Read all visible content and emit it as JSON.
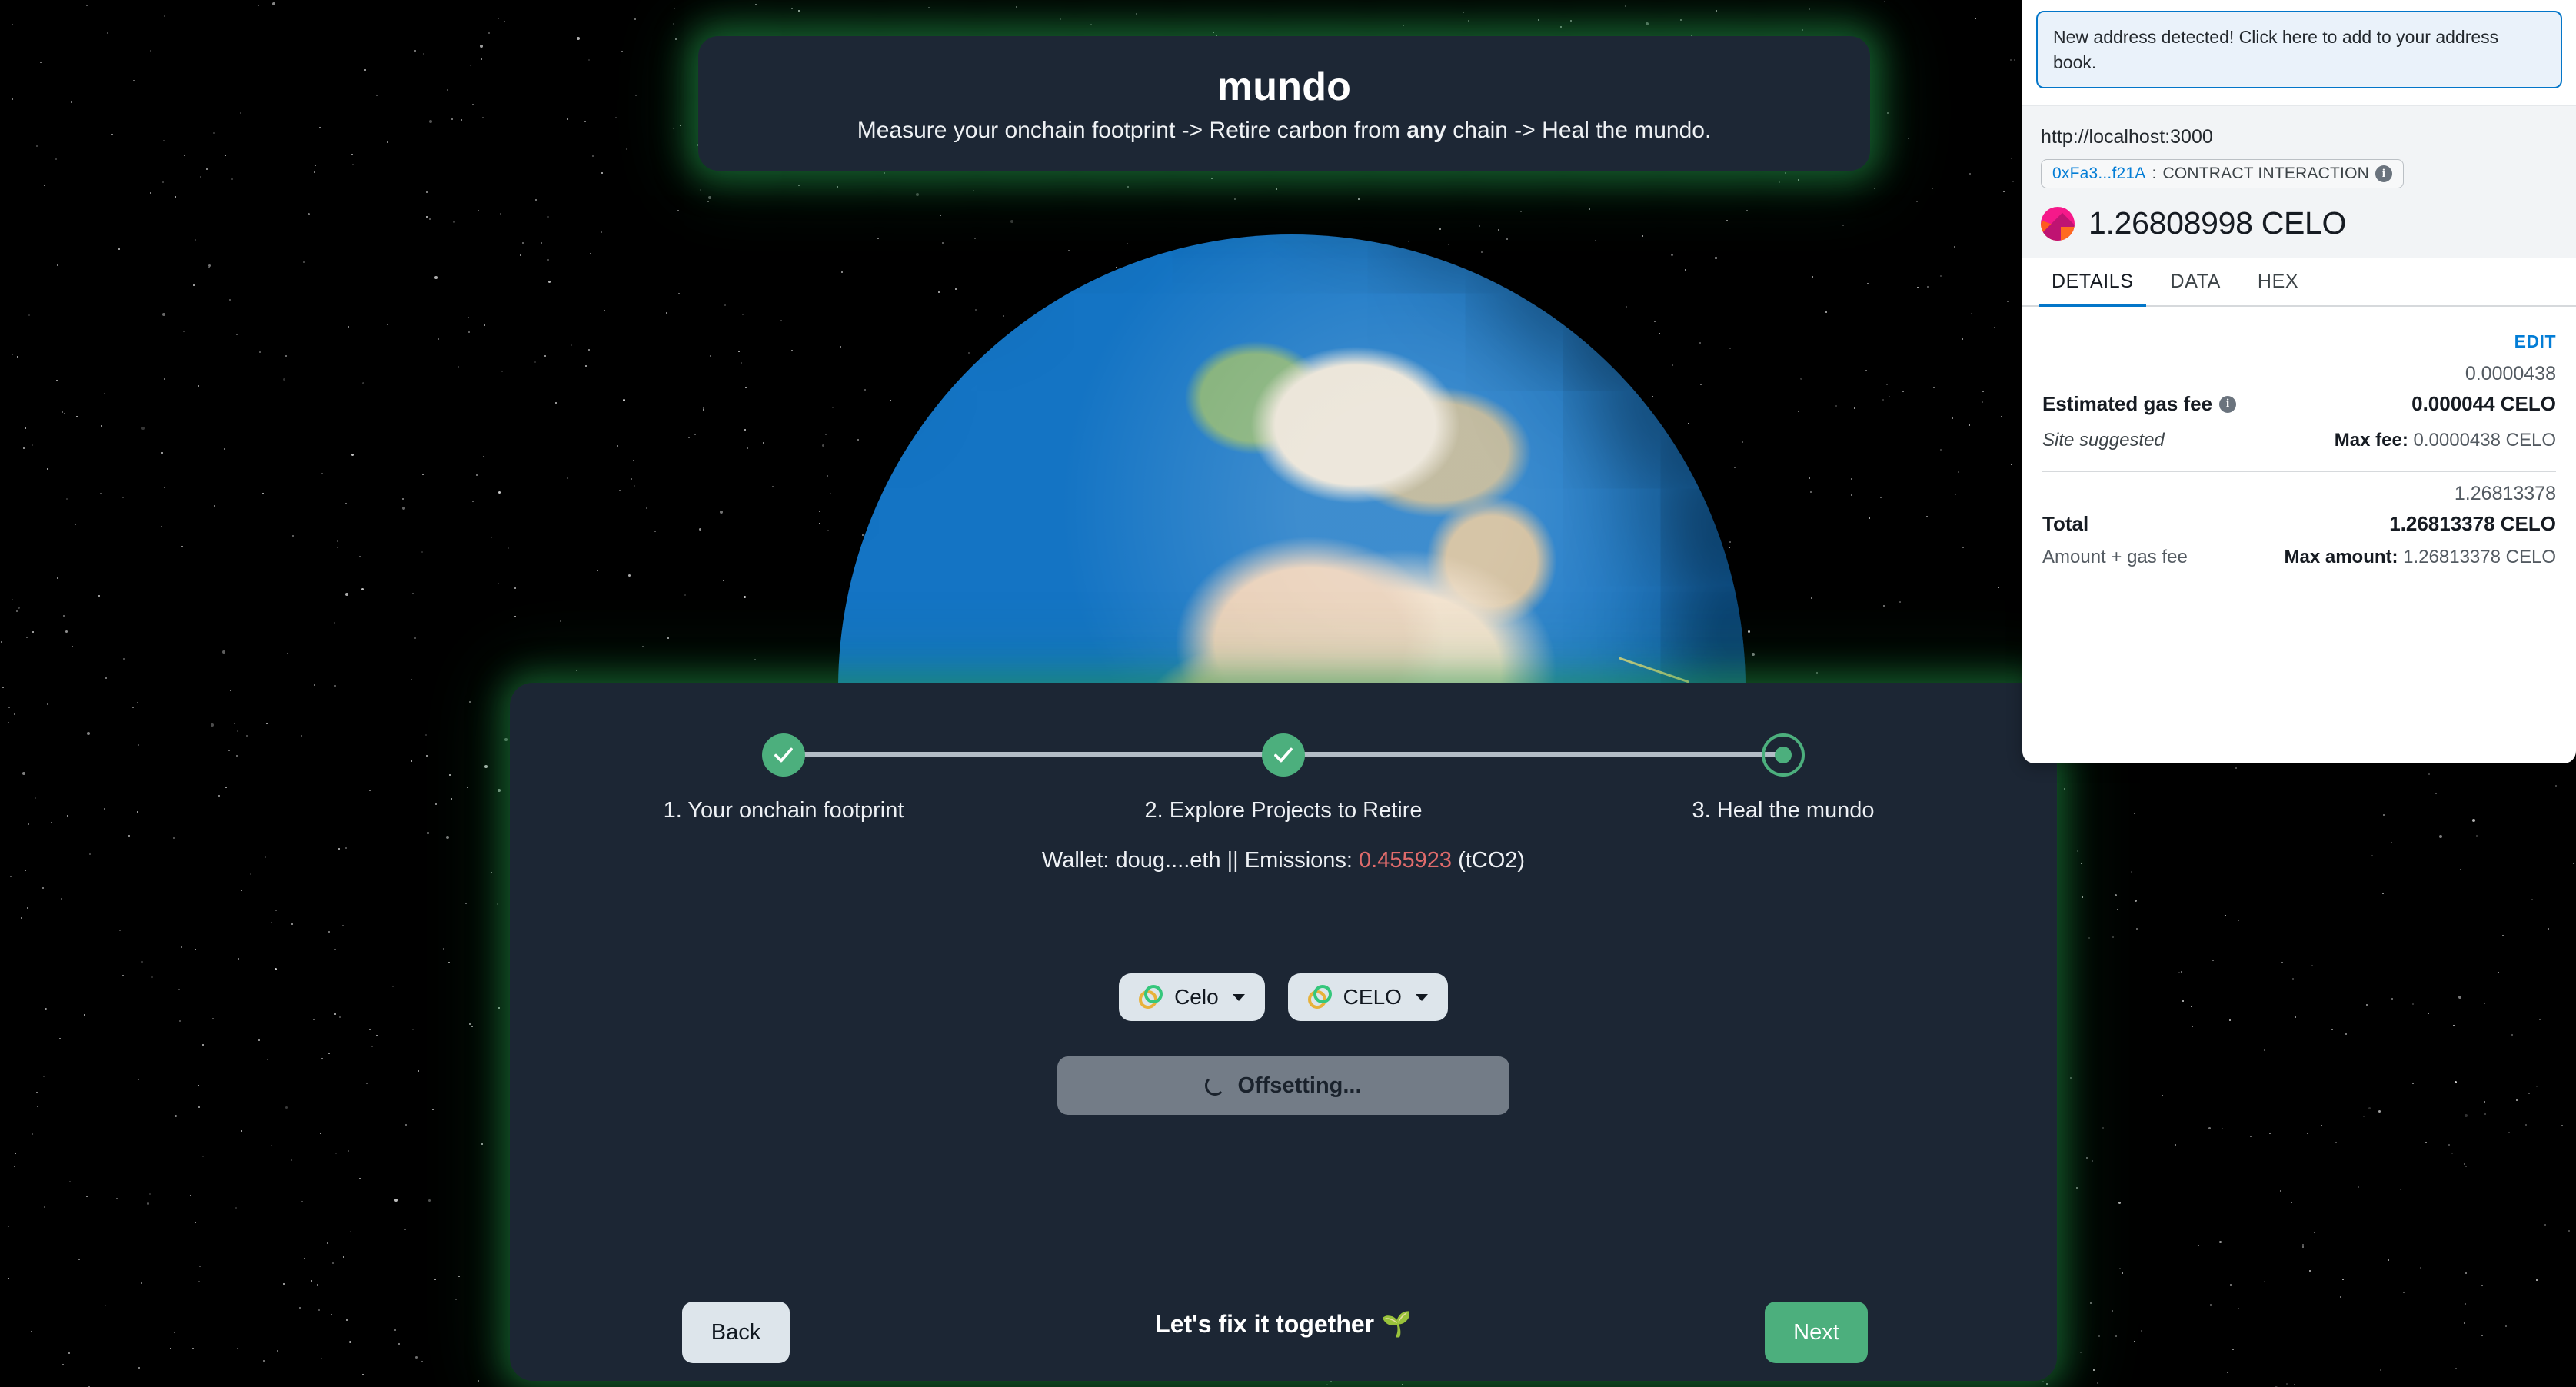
{
  "app": {
    "brand_title": "mundo",
    "tagline_before": "Measure your onchain footprint -> Retire carbon from ",
    "tagline_bold": "any",
    "tagline_after": " chain -> Heal the mundo."
  },
  "stepper": {
    "steps": [
      {
        "label": "1. Your onchain footprint",
        "state": "done",
        "icon": "check-icon"
      },
      {
        "label": "2. Explore Projects to Retire",
        "state": "done",
        "icon": "check-icon"
      },
      {
        "label": "3. Heal the mundo",
        "state": "active",
        "icon": "dot-icon"
      }
    ]
  },
  "wallet": {
    "prefix": "Wallet: doug....eth || Emissions: ",
    "emissions": "0.455923",
    "suffix": " (tCO2)"
  },
  "selectors": {
    "chain": {
      "label": "Celo",
      "icon": "celo-logo-icon"
    },
    "token": {
      "label": "CELO",
      "icon": "celo-logo-icon"
    }
  },
  "actions": {
    "offset_label": "Offsetting...",
    "back_label": "Back",
    "next_label": "Next",
    "slogan": "Let's fix it together 🌱"
  },
  "colors": {
    "accent_green": "#4caf7d",
    "card_bg": "#1c2634",
    "emissions_red": "#e06b6b",
    "metamask_blue": "#037dd6"
  },
  "metamask": {
    "toast": "New address detected! Click here to add to your address book.",
    "origin": "http://localhost:3000",
    "pill": {
      "address": "0xFa3...f21A",
      "separator": " : ",
      "type": "CONTRACT INTERACTION",
      "info_icon": "info-icon"
    },
    "amount": "1.26808998 CELO",
    "tabs": [
      {
        "label": "DETAILS",
        "active": true
      },
      {
        "label": "DATA",
        "active": false
      },
      {
        "label": "HEX",
        "active": false
      }
    ],
    "edit_label": "EDIT",
    "gas": {
      "label": "Estimated gas fee",
      "info_icon": "info-icon",
      "native": "0.0000438",
      "main": "0.000044 CELO",
      "sub_left": "Site suggested",
      "sub_right_label": "Max fee:",
      "sub_right_value": "0.0000438 CELO"
    },
    "total": {
      "label": "Total",
      "native": "1.26813378",
      "main": "1.26813378 CELO",
      "sub_left": "Amount + gas fee",
      "sub_right_label": "Max amount:",
      "sub_right_value": "1.26813378 CELO"
    }
  }
}
